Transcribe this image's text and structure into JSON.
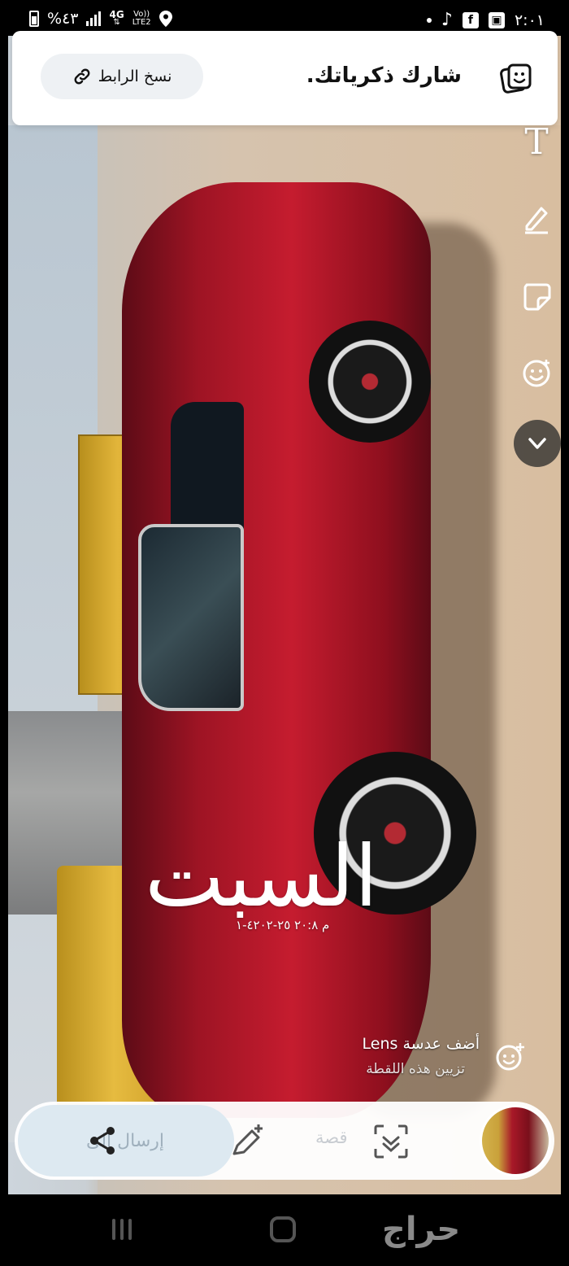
{
  "status_bar": {
    "battery_percent": "%٤٣",
    "network": "4G",
    "volte": "Vo))\nLTE2",
    "time": "٢:٠١",
    "icons": [
      "battery-icon",
      "signal-icon",
      "location-icon",
      "tiktok-icon",
      "facebook-icon",
      "gallery-icon",
      "dot-icon"
    ]
  },
  "share_card": {
    "title": "شارك ذكرياتك.",
    "copy_link_label": "نسخ الرابط",
    "icons": [
      "memories-icon",
      "link-icon"
    ]
  },
  "tools": {
    "text_glyph": "T",
    "icons": [
      "text-tool-icon",
      "pen-icon",
      "sticker-icon",
      "emoji-icon",
      "chevron-down-icon"
    ]
  },
  "caption": {
    "day": "السبت",
    "date": "م ٢٠:٨ ٢٥-٤٢٠٢-١"
  },
  "lens": {
    "title": "أضف عدسة Lens",
    "subtitle": "تزيين هذه اللقطة"
  },
  "action_bar": {
    "send_label": "إرسال إلى",
    "story_label": "قصة",
    "icons": [
      "share-icon",
      "edit-icon",
      "scan-icon"
    ]
  },
  "nav": {
    "watermark": "حراج",
    "icons": [
      "recents-icon",
      "home-icon"
    ]
  },
  "colors": {
    "accent": "#dde9f1",
    "car_red": "#c51c2f",
    "card_bg": "#ffffff"
  }
}
